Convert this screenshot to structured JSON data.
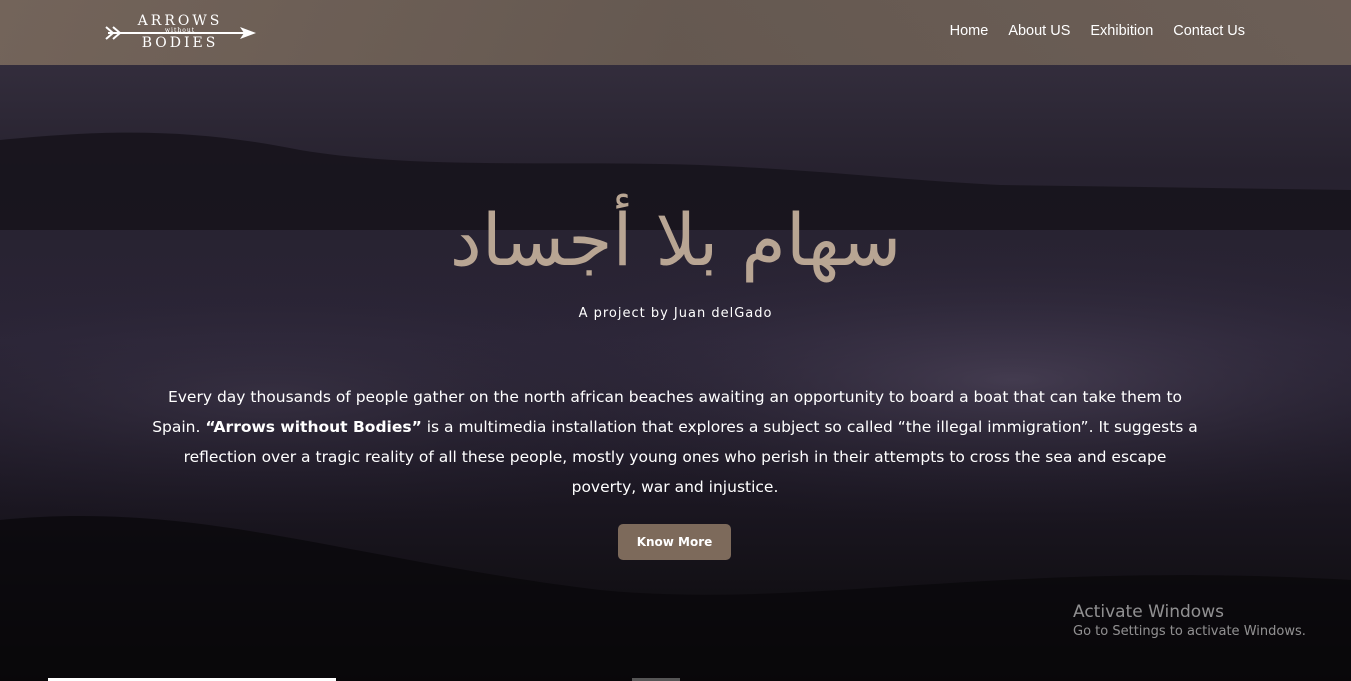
{
  "logo": {
    "line1": "ARROWS",
    "line2": "without",
    "line3": "BODIES",
    "icon": "arrow-icon"
  },
  "nav": {
    "items": [
      {
        "label": "Home"
      },
      {
        "label": "About US"
      },
      {
        "label": "Exhibition"
      },
      {
        "label": "Contact Us"
      }
    ]
  },
  "hero": {
    "title": "سهام بلا أجساد",
    "subtitle": "A project by Juan delGado",
    "description_start": "Every day thousands of people gather on the north african beaches awaiting an opportunity to board a boat that can take them to Spain. ",
    "description_bold": "“Arrows without Bodies”",
    "description_end": " is a multimedia installation that explores a subject so called “the illegal immigration”. It suggests a reflection over a tragic reality of all these people, mostly young ones who perish in their attempts to cross the sea and escape poverty, war and injustice.",
    "button_label": "Know More"
  },
  "watermark": {
    "title": "Activate Windows",
    "subtitle": "Go to Settings to activate Windows."
  },
  "colors": {
    "header": "#6f6156",
    "title": "#b8a593",
    "button": "#7d6a5b",
    "background": "#0d0b12"
  }
}
